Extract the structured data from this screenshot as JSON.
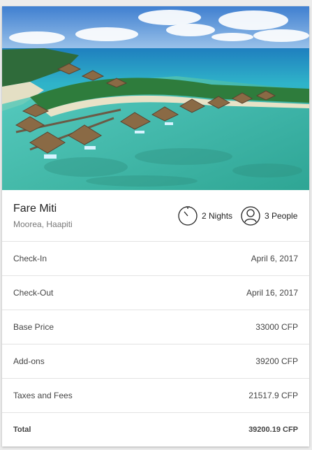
{
  "booking": {
    "hotel_name": "Fare Miti",
    "location": "Moorea, Haapiti",
    "nights": "2 Nights",
    "people": "3 People",
    "image_alt": "overwater-bungalows-lagoon"
  },
  "details": [
    {
      "label": "Check-In",
      "value": "April 6, 2017"
    },
    {
      "label": "Check-Out",
      "value": "April 16, 2017"
    },
    {
      "label": "Base Price",
      "value": "33000 CFP"
    },
    {
      "label": "Add-ons",
      "value": "39200 CFP"
    },
    {
      "label": "Taxes and Fees",
      "value": "21517.9 CFP"
    }
  ],
  "total": {
    "label": "Total",
    "value": "39200.19 CFP"
  },
  "icons": {
    "nights": "stopwatch-icon",
    "people": "person-icon"
  },
  "colors": {
    "lagoon": "#3fc8c4",
    "sky": "#5a93d8",
    "ocean": "#1f6fb0",
    "sand": "#e9e2c9"
  }
}
